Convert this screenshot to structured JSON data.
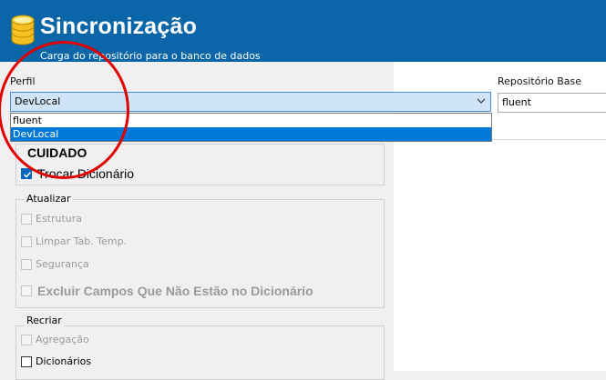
{
  "header": {
    "title": "Sincronização",
    "subtitle": "Carga do repositório para o banco de dados"
  },
  "profile": {
    "label": "Perfil",
    "selected": "DevLocal",
    "options": [
      "fluent",
      "DevLocal"
    ]
  },
  "repo_base": {
    "label": "Repositório Base",
    "value": "fluent"
  },
  "cuidado": {
    "label": "CUIDADO",
    "trocar_dicionario": "Trocar Dicionário"
  },
  "atualizar": {
    "legend": "Atualizar",
    "estrutura": "Estrutura",
    "limpar": "Limpar Tab. Temp.",
    "seguranca": "Segurança",
    "excluir": "Excluir Campos Que Não Estão no Dicionário"
  },
  "recriar": {
    "legend": "Recriar",
    "agregacao": "Agregação",
    "dicionarios": "Dicionários"
  },
  "colors": {
    "header_bg": "#0a66a8",
    "selected_item": "#0078d7",
    "annotation_circle": "#e00000"
  },
  "icons": [
    "database-icon",
    "chevron-down-icon",
    "checkmark-icon"
  ]
}
